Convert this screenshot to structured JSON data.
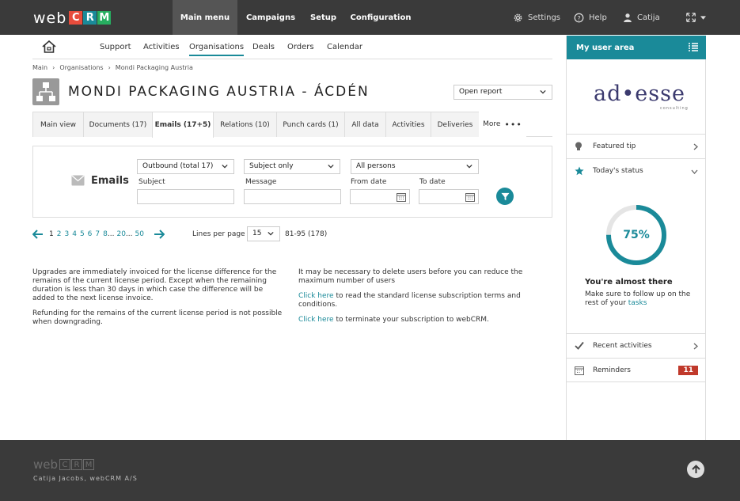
{
  "topbar": {
    "logo_web": "web",
    "logo_letters": [
      {
        "letter": "C",
        "color": "#e74c3c"
      },
      {
        "letter": "R",
        "color": "#1a8a99"
      },
      {
        "letter": "M",
        "color": "#27ae60"
      }
    ],
    "nav": [
      "Main menu",
      "Campaigns",
      "Setup",
      "Configuration"
    ],
    "settings_label": "Settings",
    "help_label": "Help",
    "user_name": "Catija"
  },
  "subnav": {
    "items": [
      "Support",
      "Activities",
      "Organisations",
      "Deals",
      "Orders",
      "Calendar"
    ],
    "active": "Organisations"
  },
  "breadcrumb": [
    "Main",
    "Organisations",
    "Mondi Packaging Austria"
  ],
  "org_title": "MONDI PACKAGING AUSTRIA - ÁCDÉN",
  "report_select": "Open report",
  "tabs": [
    "Main view",
    "Documents (17)",
    "Emails (17+5)",
    "Relations (10)",
    "Punch cards (1)",
    "All data",
    "Activities",
    "Deliveries",
    "More"
  ],
  "active_tab": "Emails (17+5)",
  "filters": {
    "section_title": "Emails",
    "direction": "Outbound (total 17)",
    "scope": "Subject only",
    "persons": "All persons",
    "subject_label": "Subject",
    "message_label": "Message",
    "from_label": "From date",
    "to_label": "To date"
  },
  "pager": {
    "current": "1",
    "pages": [
      "2",
      "3",
      "4",
      "5",
      "6",
      "7",
      "8"
    ],
    "ellipsis": "...",
    "mid": "20",
    "last": "50",
    "lines_label": "Lines per page",
    "lines_value": "15",
    "range": "81-95 (178)"
  },
  "info_left": {
    "p1": "Upgrades are immediately invoiced for the license difference for the remains of the current license period. Except when the remaining duration is less than 30 days in which case the difference will be added to the next license invoice.",
    "p2": "Refunding for the remains of the current license period is not possible when downgrading."
  },
  "info_right": {
    "p1": "It may be necessary to delete users before you can reduce the maximum number of users",
    "link": "Click here",
    "p2_rest": " to read the standard license subscription terms and conditions.",
    "p3_rest": " to terminate your subscription to webCRM."
  },
  "sidebar": {
    "title": "My user area",
    "brand_main": "ad•esse",
    "brand_sub": "consulting",
    "featured_tip": "Featured tip",
    "todays_status": "Today's status",
    "progress_percent": 75,
    "progress_label": "75%",
    "almost_title": "You're almost there",
    "almost_text": "Make sure to follow up on the rest of your ",
    "almost_link": "tasks",
    "recent_activities": "Recent activities",
    "reminders": "Reminders",
    "reminders_count": "11",
    "accent_color": "#1a8a99"
  },
  "footer": {
    "logo_web": "web",
    "logo_letters": [
      "C",
      "R",
      "M"
    ],
    "credit": "Catija Jacobs,  webCRM A/S"
  }
}
